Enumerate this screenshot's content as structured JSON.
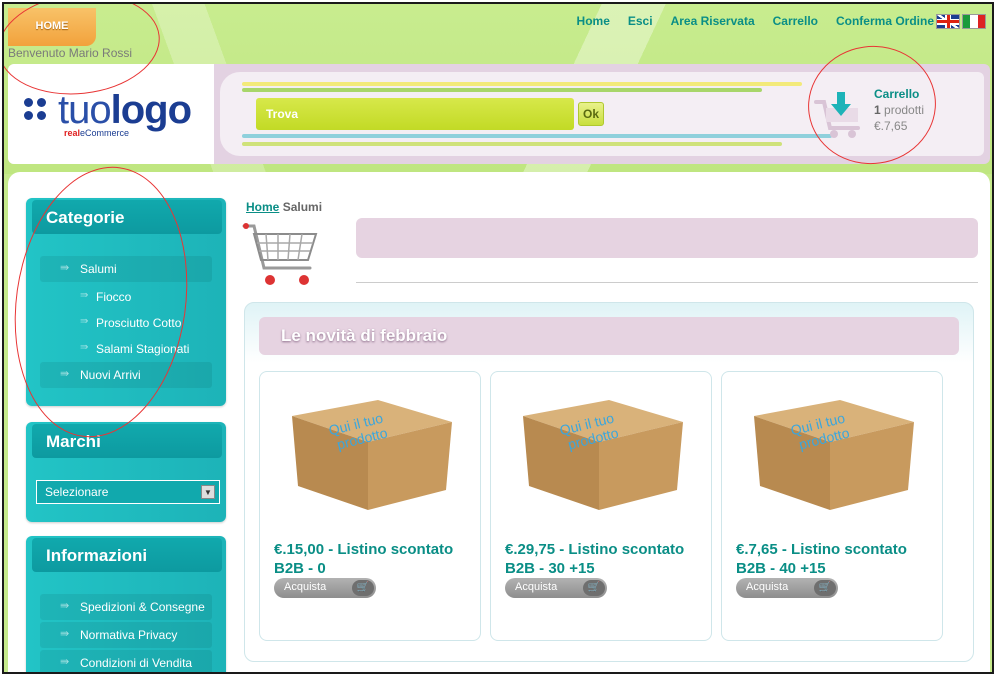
{
  "topbar": {
    "home_tab": "HOME",
    "welcome": "Benvenuto Mario Rossi",
    "nav": [
      "Home",
      "Esci",
      "Area Riservata",
      "Carrello",
      "Conferma Ordine"
    ]
  },
  "header": {
    "logo_main_thin": "tuo",
    "logo_main_bold": "logo",
    "logo_sub_red": "real",
    "logo_sub": "eCommerce",
    "search_label": "Trova",
    "search_button": "Ok",
    "cart": {
      "title": "Carrello",
      "count_number": "1",
      "count_label": "prodotti",
      "total": "€.7,65"
    }
  },
  "sidebar": {
    "categories": {
      "title": "Categorie",
      "items": [
        {
          "label": "Salumi"
        },
        {
          "label": "Fiocco"
        },
        {
          "label": "Prosciutto Cotto"
        },
        {
          "label": "Salami Stagionati"
        },
        {
          "label": "Nuovi Arrivi"
        }
      ]
    },
    "brands": {
      "title": "Marchi",
      "select_value": "Selezionare"
    },
    "info": {
      "title": "Informazioni",
      "items": [
        "Spedizioni & Consegne",
        "Normativa Privacy",
        "Condizioni di Vendita"
      ]
    }
  },
  "main": {
    "breadcrumb_home": "Home",
    "breadcrumb_current": "Salumi",
    "news_title": "Le novità di febbraio",
    "product_box_text_1": "Qui il tuo",
    "product_box_text_2": "prodotto",
    "products": [
      {
        "price_line1": "€.15,00 - Listino scontato",
        "price_line2": "B2B - 0",
        "buy_label": "Acquista"
      },
      {
        "price_line1": "€.29,75 - Listino scontato",
        "price_line2": "B2B - 30 +15",
        "buy_label": "Acquista"
      },
      {
        "price_line1": "€.7,65 - Listino scontato",
        "price_line2": "B2B - 40 +15",
        "buy_label": "Acquista"
      }
    ]
  },
  "colors": {
    "accent": "#0a8e86",
    "sidebar": "#1db3b8",
    "background": "#c6ea8c",
    "pink": "#e6d3e1",
    "home_tab": "#f2a23c",
    "annotation": "#e83535"
  }
}
